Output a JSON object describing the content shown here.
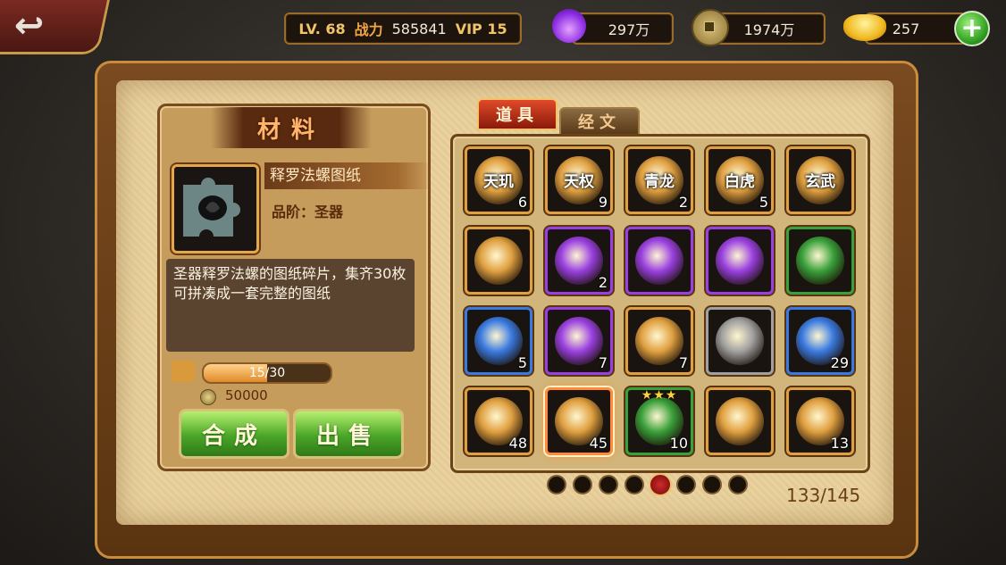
{
  "topbar": {
    "level_label": "LV. 68",
    "power_label": "战力",
    "power_value": "585841",
    "vip_label": "VIP 15",
    "soul": "297万",
    "coins": "1974万",
    "gold": "257",
    "plus": "+",
    "back_icon": "back-arrow-icon"
  },
  "panel": {
    "title": "材料",
    "item_name": "释罗法螺图纸",
    "grade": "品阶：圣器",
    "description": "圣器释罗法螺的图纸碎片，集齐30枚可拼凑成一套完整的图纸",
    "progress_text": "15/30",
    "progress_fraction": 0.5,
    "cost": "50000",
    "compose_label": "合成",
    "sell_label": "出售"
  },
  "tabs": {
    "items": "道具",
    "scripts": "经文"
  },
  "grid": [
    {
      "label": "天玑",
      "count": "6",
      "color": "#e0a040"
    },
    {
      "label": "天权",
      "count": "9",
      "color": "#e0a040"
    },
    {
      "label": "青龙",
      "count": "2",
      "color": "#e0a040"
    },
    {
      "label": "白虎",
      "count": "5",
      "color": "#e0a040"
    },
    {
      "label": "玄武",
      "count": "",
      "color": "#e0a040"
    },
    {
      "label": "",
      "count": "",
      "color": "#e0a040",
      "icon": "star-rune-icon"
    },
    {
      "label": "",
      "count": "2",
      "color": "#9a40e0",
      "icon": "purple-eye-gem-icon"
    },
    {
      "label": "",
      "count": "",
      "color": "#9a40e0",
      "icon": "purple-lightning-gem-icon"
    },
    {
      "label": "",
      "count": "",
      "color": "#9a40e0",
      "icon": "purple-diamond-gem-icon"
    },
    {
      "label": "",
      "count": "",
      "color": "#3aa03a",
      "icon": "green-orb-icon"
    },
    {
      "label": "",
      "count": "5",
      "color": "#3a7ae0",
      "icon": "blue-orb-icon"
    },
    {
      "label": "",
      "count": "7",
      "color": "#9a40e0",
      "icon": "purple-orb-icon"
    },
    {
      "label": "",
      "count": "7",
      "color": "#e0a040",
      "icon": "fire-orb-icon"
    },
    {
      "label": "",
      "count": "",
      "color": "#a0a0a0",
      "icon": "dragon-orb-icon"
    },
    {
      "label": "",
      "count": "29",
      "color": "#3a7ae0",
      "icon": "beast-orb-icon"
    },
    {
      "label": "",
      "count": "48",
      "color": "#e0a040",
      "icon": "puzzle-ring-icon"
    },
    {
      "label": "",
      "count": "45",
      "color": "#e0a040",
      "icon": "puzzle-conch-icon",
      "selected": true
    },
    {
      "label": "",
      "count": "10",
      "color": "#3aa03a",
      "icon": "green-cross-icon",
      "stars": "★★★"
    },
    {
      "label": "",
      "count": "",
      "color": "#e0a040",
      "icon": "puzzle-blade-icon"
    },
    {
      "label": "",
      "count": "13",
      "color": "#e0a040",
      "icon": "puzzle-staff-icon"
    }
  ],
  "pagination": {
    "total_pages": 8,
    "current_page": 5,
    "count_text": "133/145"
  }
}
